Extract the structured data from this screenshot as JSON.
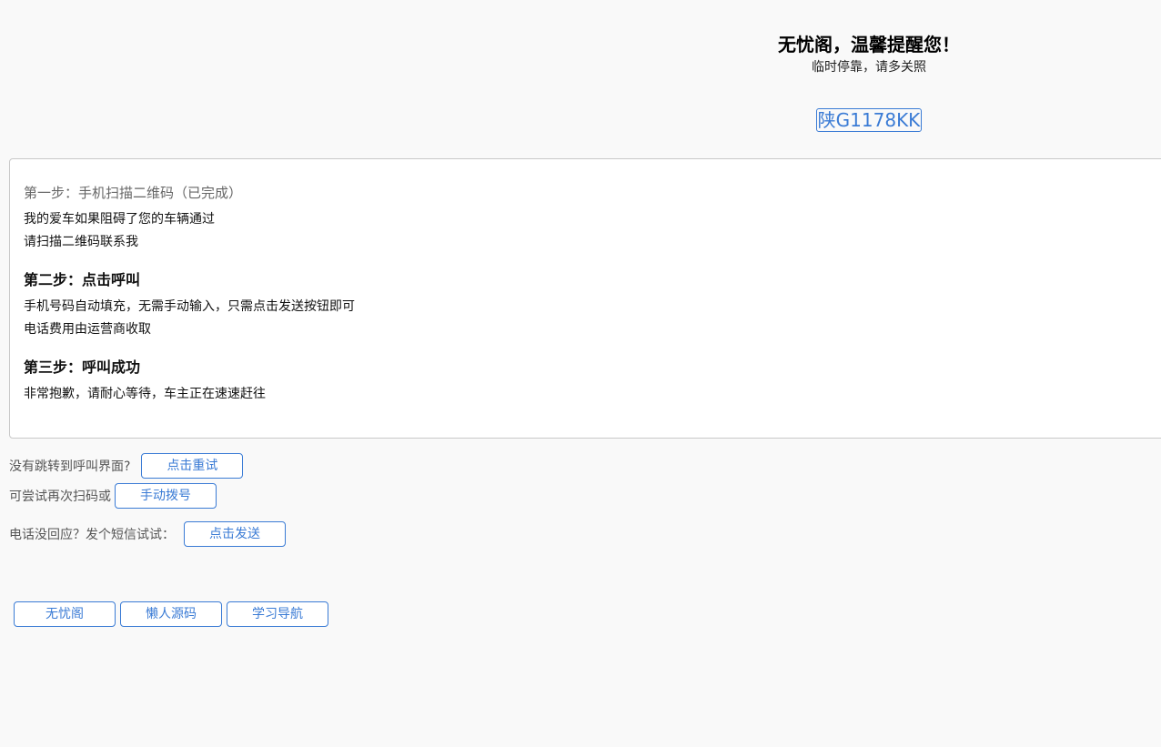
{
  "header": {
    "title": "无忧阁，温馨提醒您！",
    "subtitle": "临时停靠，请多关照",
    "plate": "陕G1178KK"
  },
  "steps": {
    "step1": {
      "title": "第一步：手机扫描二维码（已完成）",
      "lines": [
        "我的爱车如果阻碍了您的车辆通过",
        "请扫描二维码联系我"
      ]
    },
    "step2": {
      "title": "第二步：点击呼叫",
      "lines": [
        "手机号码自动填充，无需手动输入，只需点击发送按钮即可",
        "电话费用由运营商收取"
      ]
    },
    "step3": {
      "title": "第三步：呼叫成功",
      "lines": [
        "非常抱歉，请耐心等待，车主正在速速赶往"
      ]
    }
  },
  "actions": {
    "retry": {
      "prompt": "没有跳转到呼叫界面?",
      "button": "点击重试"
    },
    "dial": {
      "prompt": "可尝试再次扫码或",
      "button": "手动拨号"
    },
    "sms": {
      "prompt": "电话没回应？发个短信试试：",
      "button": "点击发送"
    }
  },
  "footer": {
    "links": [
      "无忧阁",
      "懒人源码",
      "学习导航"
    ]
  },
  "colors": {
    "accent": "#3a7bd5",
    "background": "#f9f9f9",
    "box_border": "#c8c8c8"
  }
}
